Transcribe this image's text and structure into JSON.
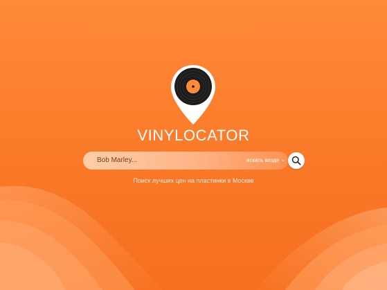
{
  "brand": {
    "name": "VINYLOCATOR"
  },
  "search": {
    "query": "Bob Marley...",
    "scope_label": "искать везде",
    "scope_icon": "chevron-down-icon",
    "button_icon": "search-icon"
  },
  "tagline": "Поиск лучших цен на пластинки в Москве",
  "colors": {
    "background": "#fb7c2b",
    "accent": "#ff8a3a",
    "vinyl": "#1e1e1e",
    "label": "#ff8a3a",
    "text": "#ffffff"
  }
}
